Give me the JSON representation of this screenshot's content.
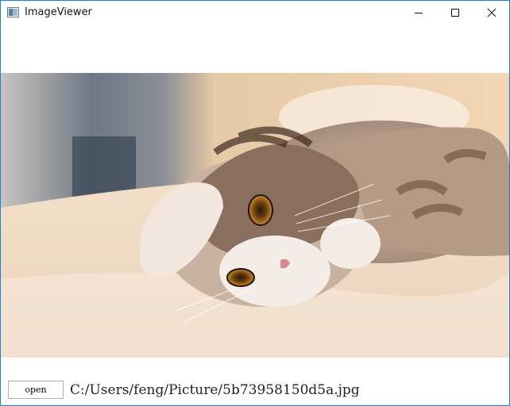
{
  "window": {
    "title": "ImageViewer",
    "controls": {
      "minimize_icon": "minimize-icon",
      "maximize_icon": "maximize-icon",
      "close_icon": "close-icon"
    },
    "accent_border": "#1e7fd6"
  },
  "viewer": {
    "image_subject": "kitten lying on bed"
  },
  "footer": {
    "open_label": "open",
    "file_path": "C:/Users/feng/Picture/5b73958150d5a.jpg"
  }
}
